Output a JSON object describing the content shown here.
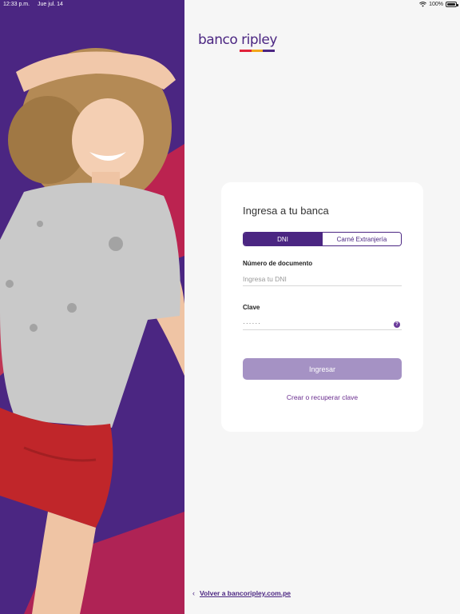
{
  "status_bar": {
    "time": "12:33 p.m.",
    "date": "Jue jul. 14",
    "battery": "100%"
  },
  "brand": {
    "name": "banco ripley",
    "colors": {
      "primary": "#4b2682",
      "stripe": [
        "#e0223a",
        "#f2a71b",
        "#4b2682"
      ]
    }
  },
  "login": {
    "title": "Ingresa a tu banca",
    "tabs": [
      {
        "label": "DNI",
        "active": true
      },
      {
        "label": "Carné Extranjería",
        "active": false
      }
    ],
    "document_label": "Número de documento",
    "document_placeholder": "Ingresa tu DNI",
    "password_label": "Clave",
    "password_value": "······",
    "help_glyph": "?",
    "submit_label": "Ingresar",
    "recover_link": "Crear o recuperar clave"
  },
  "footer": {
    "back_icon": "‹",
    "back_link": "Volver a bancoripley.com.pe"
  }
}
